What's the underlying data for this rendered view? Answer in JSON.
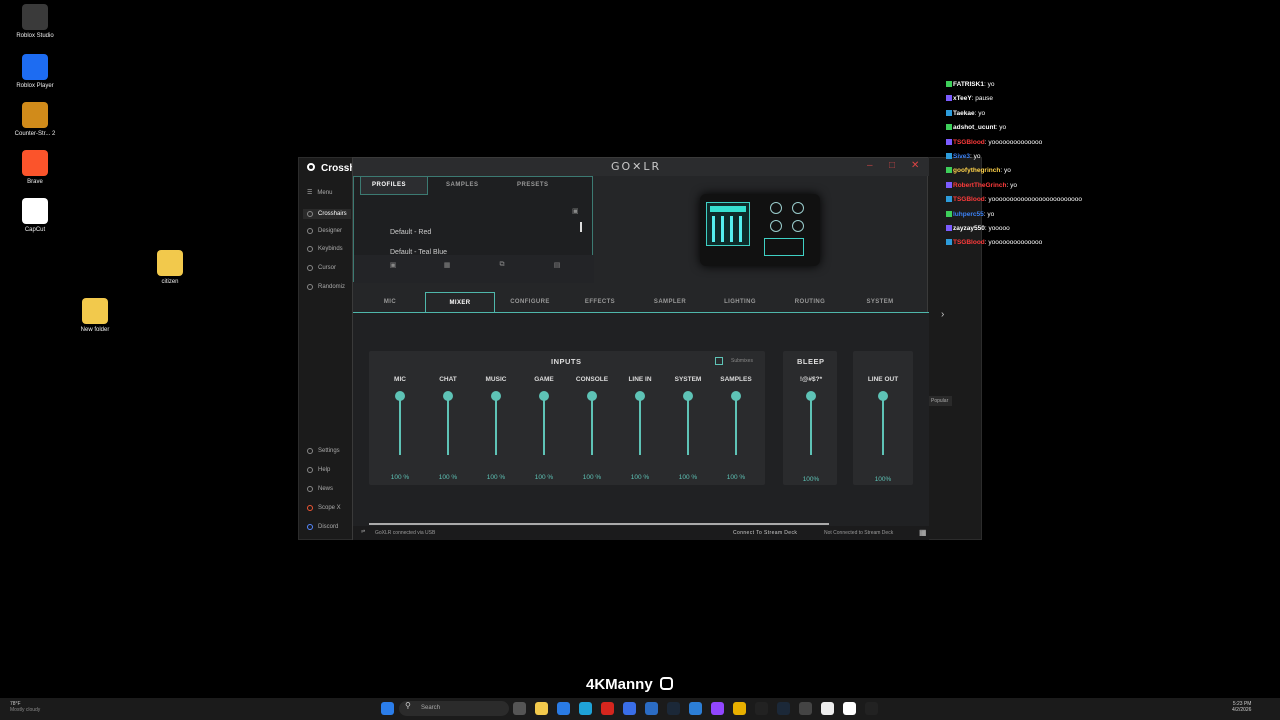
{
  "desktop": {
    "icons": [
      {
        "label": "Roblox Studio",
        "icon": "roblox-studio-icon",
        "color": "#3a3a3a"
      },
      {
        "label": "Roblox Player",
        "icon": "roblox-player-icon",
        "color": "#1d6cf2"
      },
      {
        "label": "Counter-Str... 2",
        "icon": "counter-strike-icon",
        "color": "#d18b1a"
      },
      {
        "label": "Brave",
        "icon": "brave-icon",
        "color": "#fb542b"
      },
      {
        "label": "CapCut",
        "icon": "capcut-icon",
        "color": "#ffffff"
      },
      {
        "label": "citizen",
        "icon": "folder-icon",
        "color": "#f2c94c"
      },
      {
        "label": "New folder",
        "icon": "folder-icon",
        "color": "#f2c94c"
      }
    ]
  },
  "bg_app": {
    "title": "Crossh",
    "menu": "Menu",
    "nav": [
      "Crosshairs",
      "Designer",
      "Keybinds",
      "Cursor",
      "Randomiz"
    ],
    "bottom_nav": [
      "Settings",
      "Help",
      "News",
      "Scope X",
      "Discord"
    ],
    "popular_label": "Popular"
  },
  "goxlr": {
    "logo": "GO✕LR",
    "profiles_tabs": [
      "PROFILES",
      "SAMPLES",
      "PRESETS"
    ],
    "profiles": [
      "Default - Red",
      "Default - Teal Blue"
    ],
    "tabs": [
      "MIC",
      "MIXER",
      "CONFIGURE",
      "EFFECTS",
      "SAMPLER",
      "LIGHTING",
      "ROUTING",
      "SYSTEM"
    ],
    "active_tab": "MIXER",
    "inputs_title": "INPUTS",
    "submixes_label": "Submixes",
    "channels": [
      {
        "label": "MIC",
        "value": "100 %",
        "level": 1.0
      },
      {
        "label": "CHAT",
        "value": "100 %",
        "level": 1.0
      },
      {
        "label": "MUSIC",
        "value": "100 %",
        "level": 1.0
      },
      {
        "label": "GAME",
        "value": "100 %",
        "level": 1.0
      },
      {
        "label": "CONSOLE",
        "value": "100 %",
        "level": 1.0
      },
      {
        "label": "LINE IN",
        "value": "100 %",
        "level": 1.0
      },
      {
        "label": "SYSTEM",
        "value": "100 %",
        "level": 1.0
      },
      {
        "label": "SAMPLES",
        "value": "100 %",
        "level": 1.0
      }
    ],
    "bleep": {
      "title": "BLEEP",
      "label": "!@#$?*",
      "value": "100%",
      "level": 1.0
    },
    "lineout": {
      "label": "LINE OUT",
      "value": "100%",
      "level": 1.0
    },
    "status": {
      "left": "GoXLR connected via USB",
      "connect": "Connect To Stream Deck",
      "not_connected": "Not Connected to Stream Deck"
    },
    "accent": "#5ec3b6"
  },
  "chat": [
    {
      "user": "FATRISK1",
      "msg": "yo",
      "color": "#ffffff"
    },
    {
      "user": "xTeeY",
      "msg": "pause",
      "color": "#ffffff"
    },
    {
      "user": "Taekae",
      "msg": "yo",
      "color": "#ffffff"
    },
    {
      "user": "adshot_ucunt",
      "msg": "yo",
      "color": "#ffffff"
    },
    {
      "user": "TSGBlood",
      "msg": "yoooooooooooooo",
      "color": "#ff3b3b"
    },
    {
      "user": "Sive3",
      "msg": "yo",
      "color": "#3b82f6"
    },
    {
      "user": "goofythegrinch",
      "msg": "yo",
      "color": "#ffd24a"
    },
    {
      "user": "RobertTheGrinch",
      "msg": "yo",
      "color": "#ff3b3b"
    },
    {
      "user": "TSGBlood",
      "msg": "yooooooooooooooooooooooooo",
      "color": "#ff3b3b"
    },
    {
      "user": "luhperc55",
      "msg": "yo",
      "color": "#3b82f6"
    },
    {
      "user": "zayzay550",
      "msg": "yooooo",
      "color": "#ffffff"
    },
    {
      "user": "TSGBlood",
      "msg": "yoooooooooooooo",
      "color": "#ff3b3b"
    }
  ],
  "watermark": "4KManny",
  "taskbar": {
    "weather_temp": "78°F",
    "weather_desc": "Mostly cloudy",
    "search_placeholder": "Search",
    "time": "5:23 PM",
    "date": "4/2/2026"
  }
}
